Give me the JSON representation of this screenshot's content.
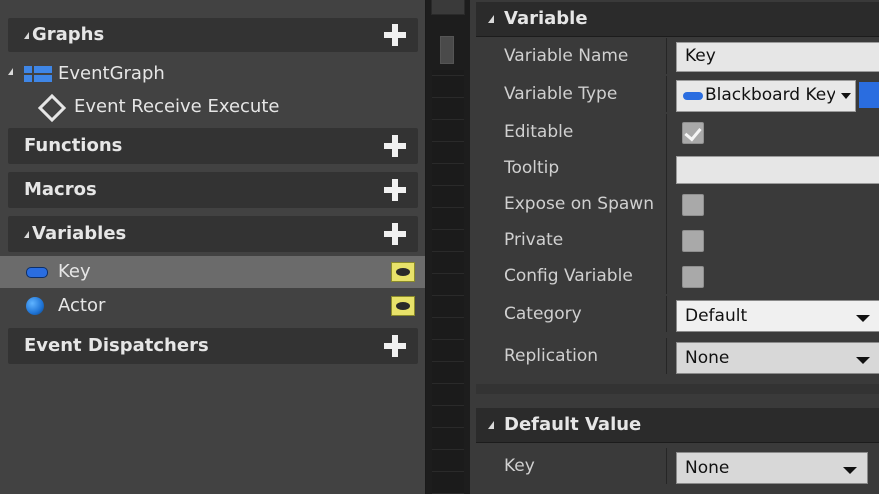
{
  "my_blueprint": {
    "sections": {
      "graphs": {
        "title": "Graphs"
      },
      "functions": {
        "title": "Functions"
      },
      "macros": {
        "title": "Macros"
      },
      "variables": {
        "title": "Variables"
      },
      "event_dispatchers": {
        "title": "Event Dispatchers"
      }
    },
    "graph_items": [
      {
        "label": "EventGraph",
        "icon": "event-graph-icon"
      },
      {
        "label": "Event Receive Execute",
        "icon": "event-node-icon"
      }
    ],
    "variables": [
      {
        "label": "Key",
        "icon": "blackboard-key-pill-icon",
        "selected": true,
        "visibility": "eye-icon"
      },
      {
        "label": "Actor",
        "icon": "actor-sphere-icon",
        "selected": false,
        "visibility": "eye-icon"
      }
    ]
  },
  "details": {
    "variable_section": {
      "title": "Variable",
      "rows": {
        "name": {
          "label": "Variable Name",
          "value": "Key"
        },
        "type": {
          "label": "Variable Type",
          "value": "Blackboard Key"
        },
        "editable": {
          "label": "Editable",
          "checked": true
        },
        "tooltip": {
          "label": "Tooltip",
          "value": ""
        },
        "expose": {
          "label": "Expose on Spawn",
          "checked": false
        },
        "private": {
          "label": "Private",
          "checked": false
        },
        "config": {
          "label": "Config Variable",
          "checked": false
        },
        "category": {
          "label": "Category",
          "value": "Default"
        },
        "replication": {
          "label": "Replication",
          "value": "None"
        }
      }
    },
    "default_section": {
      "title": "Default Value",
      "rows": {
        "key": {
          "label": "Key",
          "value": "None"
        }
      }
    }
  },
  "colors": {
    "panel_bg": "#424242",
    "selected_row": "#6b6b6b",
    "accent_blue": "#2a6de0",
    "eye_badge": "#e8e26a"
  }
}
